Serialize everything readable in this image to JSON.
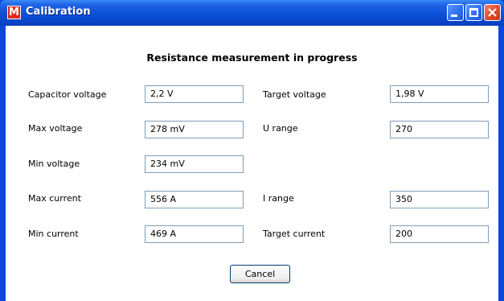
{
  "window": {
    "title": "Calibration",
    "logo_letter": "M"
  },
  "heading": "Resistance measurement in progress",
  "fields": {
    "capacitor_voltage": {
      "label": "Capacitor voltage",
      "value": "2,2 V"
    },
    "max_voltage": {
      "label": "Max voltage",
      "value": "278 mV"
    },
    "min_voltage": {
      "label": "Min voltage",
      "value": "234 mV"
    },
    "max_current": {
      "label": "Max current",
      "value": "556 A"
    },
    "min_current": {
      "label": "Min current",
      "value": "469 A"
    },
    "target_voltage": {
      "label": "Target voltage",
      "value": "1,98 V"
    },
    "u_range": {
      "label": "U range",
      "value": "270"
    },
    "i_range": {
      "label": "I range",
      "value": "350"
    },
    "target_current": {
      "label": "Target current",
      "value": "200"
    }
  },
  "cancel_label": "Cancel",
  "colors": {
    "titlebar": "#0b4fd8",
    "close_button": "#e04a28",
    "field_border": "#7f9db9"
  }
}
